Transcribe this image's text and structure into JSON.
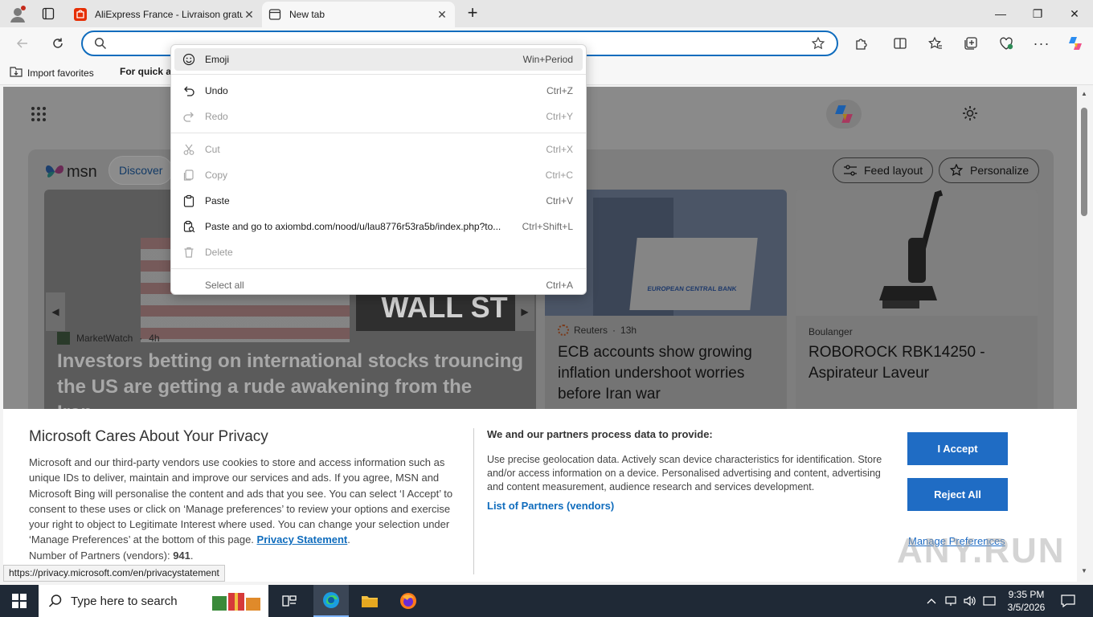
{
  "tabs": [
    {
      "title": "AliExpress France - Livraison gratu",
      "favicon_color": "#e62e04"
    },
    {
      "title": "New tab"
    }
  ],
  "window": {
    "minimize": "—",
    "maximize": "❐",
    "close": "✕"
  },
  "addressbar": {
    "value": "",
    "placeholder": ""
  },
  "bookmarks": {
    "import": "Import favorites",
    "quick_access": "For quick ac"
  },
  "msn": {
    "logo_text": "msn",
    "discover": "Discover",
    "feed_layout": "Feed layout",
    "personalize": "Personalize",
    "main_story": {
      "source": "MarketWatch",
      "age": "4h",
      "headline": "Investors betting on international stocks trouncing the US are getting a rude awakening from the Iran...",
      "image_text": "WALL ST"
    },
    "story2": {
      "source": "Reuters",
      "age": "13h",
      "headline": "ECB accounts show growing inflation undershoot worries before Iran war",
      "image_text": "EUROPEAN CENTRAL BANK"
    },
    "story3": {
      "source": "Boulanger",
      "headline": "ROBOROCK RBK14250 - Aspirateur Laveur"
    }
  },
  "context_menu": {
    "items": [
      {
        "label": "Emoji",
        "shortcut": "Win+Period",
        "icon": "emoji-icon",
        "disabled": false
      },
      {
        "label": "Undo",
        "shortcut": "Ctrl+Z",
        "icon": "undo-icon",
        "disabled": false
      },
      {
        "label": "Redo",
        "shortcut": "Ctrl+Y",
        "icon": "redo-icon",
        "disabled": true
      },
      {
        "label": "Cut",
        "shortcut": "Ctrl+X",
        "icon": "cut-icon",
        "disabled": true
      },
      {
        "label": "Copy",
        "shortcut": "Ctrl+C",
        "icon": "copy-icon",
        "disabled": true
      },
      {
        "label": "Paste",
        "shortcut": "Ctrl+V",
        "icon": "paste-icon",
        "disabled": false
      },
      {
        "label": "Paste and go to axiombd.com/nood/u/lau8776r53ra5b/index.php?to...",
        "shortcut": "Ctrl+Shift+L",
        "icon": "paste-go-icon",
        "disabled": false
      },
      {
        "label": "Delete",
        "shortcut": "",
        "icon": "delete-icon",
        "disabled": true
      },
      {
        "label": "Select all",
        "shortcut": "Ctrl+A",
        "icon": "",
        "disabled": false
      }
    ]
  },
  "privacy": {
    "title": "Microsoft Cares About Your Privacy",
    "body": "Microsoft and our third-party vendors use cookies to store and access information such as unique IDs to deliver, maintain and improve our services and ads. If you agree, MSN and Microsoft Bing will personalise the content and ads that you see. You can select ‘I Accept’ to consent to these uses or click on ‘Manage preferences’ to review your options and exercise your right to object to Legitimate Interest where used.  You can change your selection under ‘Manage Preferences’ at the bottom of this page.",
    "privacy_link": "Privacy Statement",
    "partners_label": "Number of Partners (vendors):",
    "partners_count": "941",
    "right_title": "We and our partners process data to provide:",
    "right_body": "Use precise geolocation data. Actively scan device characteristics for identification. Store and/or access information on a device. Personalised advertising and content, advertising and content measurement, audience research and services development.",
    "partners_link": "List of Partners (vendors)",
    "accept": "I Accept",
    "reject": "Reject All",
    "manage": "Manage Preferences"
  },
  "status_url": "https://privacy.microsoft.com/en/privacystatement",
  "taskbar": {
    "search_placeholder": "Type here to search",
    "time": "9:35 PM",
    "date": "3/5/2026"
  },
  "watermark": "ANY.RUN"
}
